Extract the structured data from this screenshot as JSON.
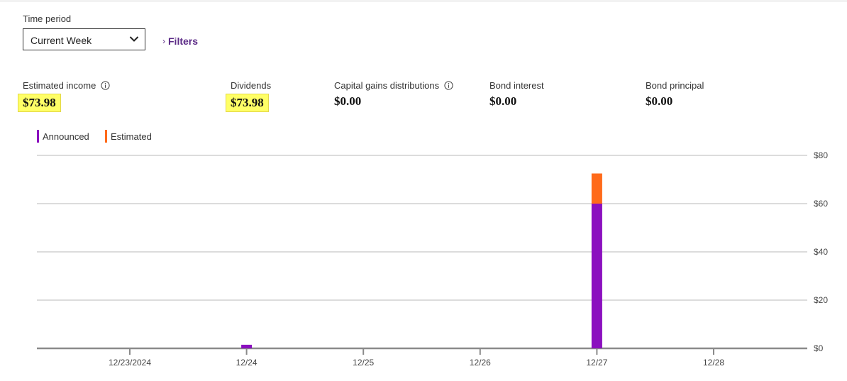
{
  "time_period": {
    "label": "Time period",
    "selected": "Current Week"
  },
  "filters": {
    "label": "Filters"
  },
  "metrics": {
    "estimated_income": {
      "label": "Estimated income",
      "value": "$73.98"
    },
    "dividends": {
      "label": "Dividends",
      "value": "$73.98"
    },
    "capital_gains": {
      "label": "Capital gains distributions",
      "value": "$0.00"
    },
    "bond_interest": {
      "label": "Bond interest",
      "value": "$0.00"
    },
    "bond_principal": {
      "label": "Bond principal",
      "value": "$0.00"
    }
  },
  "colors": {
    "announced": "#8b0fbf",
    "estimated": "#ff6a1a",
    "highlight": "#ffff66",
    "link": "#5b2a86"
  },
  "chart_data": {
    "type": "bar",
    "stacked": true,
    "categories": [
      "12/23/2024",
      "12/24",
      "12/25",
      "12/26",
      "12/27",
      "12/28"
    ],
    "series": [
      {
        "name": "Announced",
        "color": "#8b0fbf",
        "values": [
          0,
          1.5,
          0,
          0,
          60,
          0
        ]
      },
      {
        "name": "Estimated",
        "color": "#ff6a1a",
        "values": [
          0,
          0,
          0,
          0,
          12.5,
          0
        ]
      }
    ],
    "y_ticks": [
      "$0",
      "$20",
      "$40",
      "$60",
      "$80"
    ],
    "ylim": [
      0,
      80
    ],
    "grid": true,
    "legend_position": "top-left",
    "y_axis_position": "right"
  }
}
